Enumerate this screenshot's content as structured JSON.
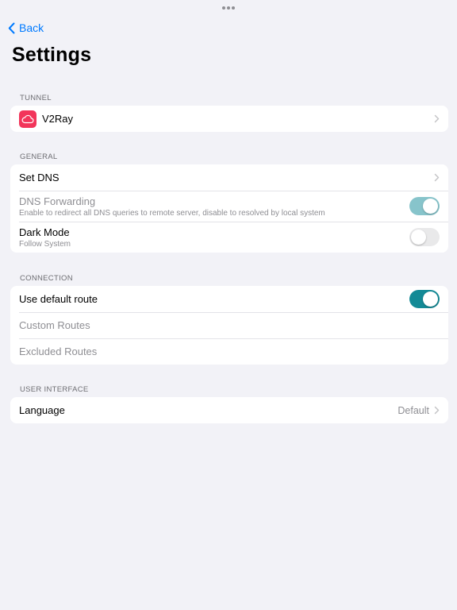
{
  "window": {
    "title": "Settings",
    "back_label": "Back"
  },
  "colors": {
    "accent": "#007aff",
    "toggle_on": "#138a96",
    "app_icon": "#f2355a",
    "background": "#f2f2f7"
  },
  "sections": {
    "tunnel": {
      "header": "TUNNEL",
      "items": [
        {
          "label": "V2Ray",
          "icon": "cloud-icon"
        }
      ]
    },
    "general": {
      "header": "GENERAL",
      "set_dns": {
        "label": "Set DNS"
      },
      "dns_forwarding": {
        "label": "DNS Forwarding",
        "subtitle": "Enable to redirect all DNS queries to remote server, disable to resolved by local system",
        "enabled": true,
        "disabled_state": true
      },
      "dark_mode": {
        "label": "Dark Mode",
        "subtitle": "Follow System",
        "enabled": false
      }
    },
    "connection": {
      "header": "CONNECTION",
      "use_default_route": {
        "label": "Use default route",
        "enabled": true
      },
      "custom_routes": {
        "label": "Custom Routes"
      },
      "excluded_routes": {
        "label": "Excluded Routes"
      }
    },
    "user_interface": {
      "header": "USER INTERFACE",
      "language": {
        "label": "Language",
        "value": "Default"
      }
    }
  }
}
